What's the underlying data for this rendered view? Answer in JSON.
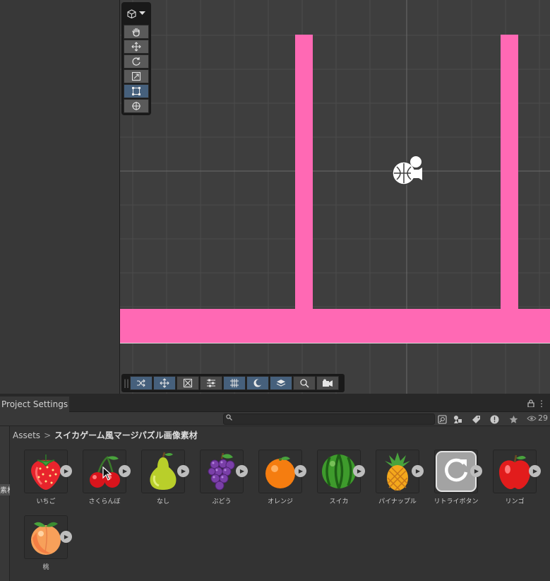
{
  "project_panel": {
    "tab_title": "Project Settings",
    "search_placeholder": "",
    "hidden_count": "29",
    "left_cut_label": "素材",
    "breadcrumb": {
      "root": "Assets",
      "separator": ">",
      "current": "スイカゲーム風マージパズル画像素材"
    }
  },
  "assets": [
    {
      "label": "いちご",
      "icon": "strawberry-icon"
    },
    {
      "label": "さくらんぼ",
      "icon": "cherry-icon"
    },
    {
      "label": "なし",
      "icon": "pear-icon"
    },
    {
      "label": "ぶどう",
      "icon": "grape-icon"
    },
    {
      "label": "オレンジ",
      "icon": "orange-icon"
    },
    {
      "label": "スイカ",
      "icon": "watermelon-icon"
    },
    {
      "label": "パイナップル",
      "icon": "pineapple-icon"
    },
    {
      "label": "リトライボタン",
      "icon": "retry-icon"
    },
    {
      "label": "リンゴ",
      "icon": "apple-icon"
    },
    {
      "label": "桃",
      "icon": "peach-icon"
    }
  ],
  "colors": {
    "wall": "#ff69b4",
    "scene_bg": "#3e3e3e",
    "active_tool": "#46607c",
    "panel_bg": "#333333"
  }
}
